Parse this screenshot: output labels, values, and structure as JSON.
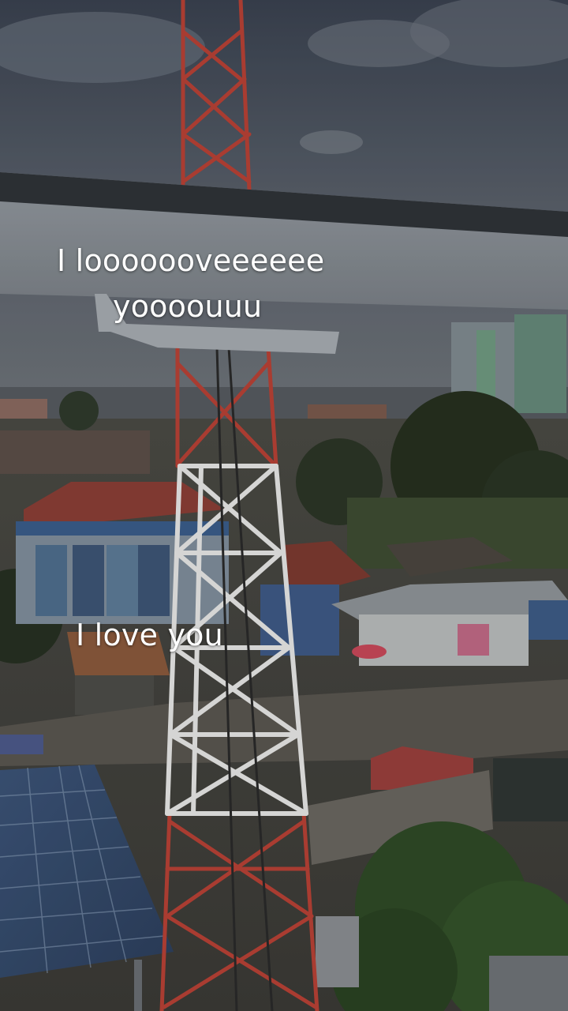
{
  "overlay": {
    "line1": "I looooooveeeeee",
    "line2": "yoooouuu",
    "line3": "I love you"
  }
}
